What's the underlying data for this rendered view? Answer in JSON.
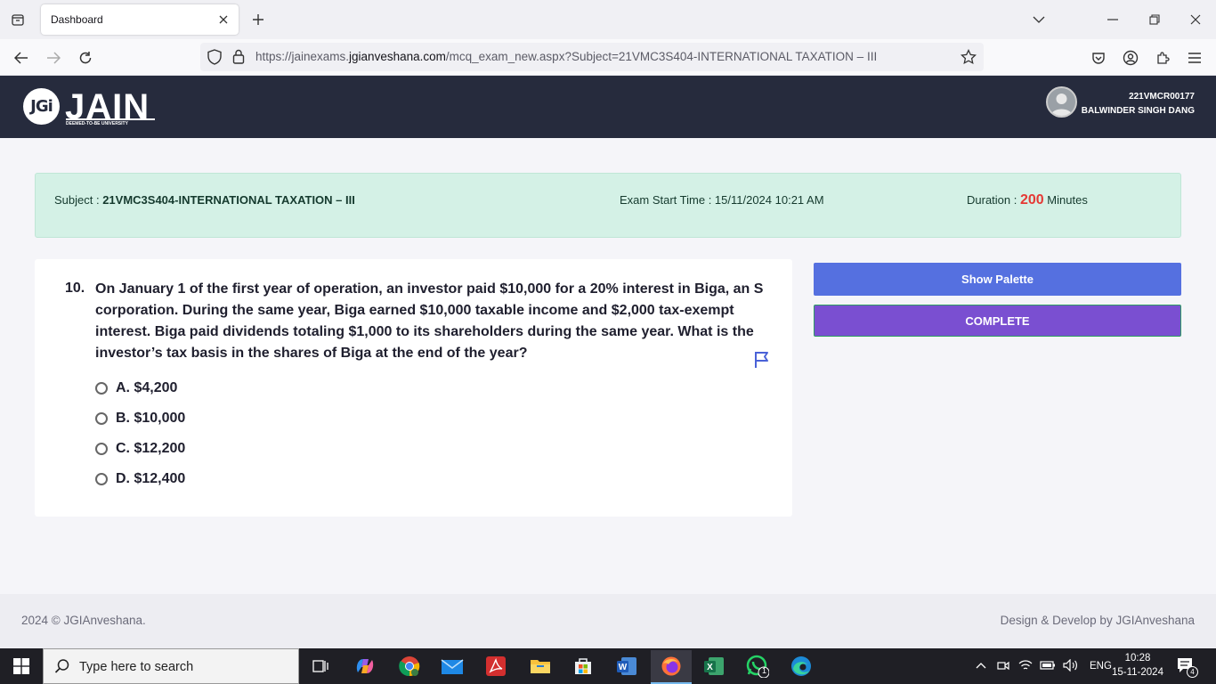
{
  "browser": {
    "tab_title": "Dashboard",
    "url_prefix": "https://jainexams.",
    "url_domain": "jgianveshana.com",
    "url_path": "/mcq_exam_new.aspx?Subject=21VMC3S404-INTERNATIONAL TAXATION – III"
  },
  "header": {
    "logo_mark": "JGi",
    "logo_text": "JAIN",
    "logo_subtext": "DEEMED-TO-BE UNIVERSITY",
    "user_id": "221VMCR00177",
    "user_name": "BALWINDER SINGH DANG"
  },
  "exam": {
    "subject_label": "Subject : ",
    "subject_value": "21VMC3S404-INTERNATIONAL TAXATION – III",
    "start_label": "Exam Start Time : ",
    "start_value": "15/11/2024 10:21 AM",
    "duration_label": "Duration : ",
    "duration_value": "200",
    "duration_unit": " Minutes"
  },
  "question": {
    "number": "10.",
    "text": "On January 1 of the first year of operation, an investor paid $10,000 for a 20% interest in Biga, an S corporation. During the same year, Biga earned $10,000 taxable income and $2,000 tax-exempt interest. Biga paid dividends totaling $1,000 to its shareholders during the same year. What is the investor’s tax basis in the shares of Biga at the end of the year?",
    "options": [
      {
        "label": "A. $4,200"
      },
      {
        "label": "B. $10,000"
      },
      {
        "label": "C. $12,200"
      },
      {
        "label": "D. $12,400"
      }
    ]
  },
  "actions": {
    "show_palette": "Show Palette",
    "complete": "COMPLETE"
  },
  "footer": {
    "copyright": "2024 © JGIAnveshana.",
    "credit": "Design & Develop by JGIAnveshana"
  },
  "taskbar": {
    "search_placeholder": "Type here to search",
    "whatsapp_badge": "1",
    "language": "ENG",
    "time": "10:28",
    "date": "15-11-2024",
    "notification_count": "4"
  },
  "colors": {
    "header_bg": "#262b3d",
    "subject_bg": "#d4f1e6",
    "palette_btn": "#5570e0",
    "complete_btn": "#7a4fd1",
    "duration_accent": "#e53935"
  }
}
